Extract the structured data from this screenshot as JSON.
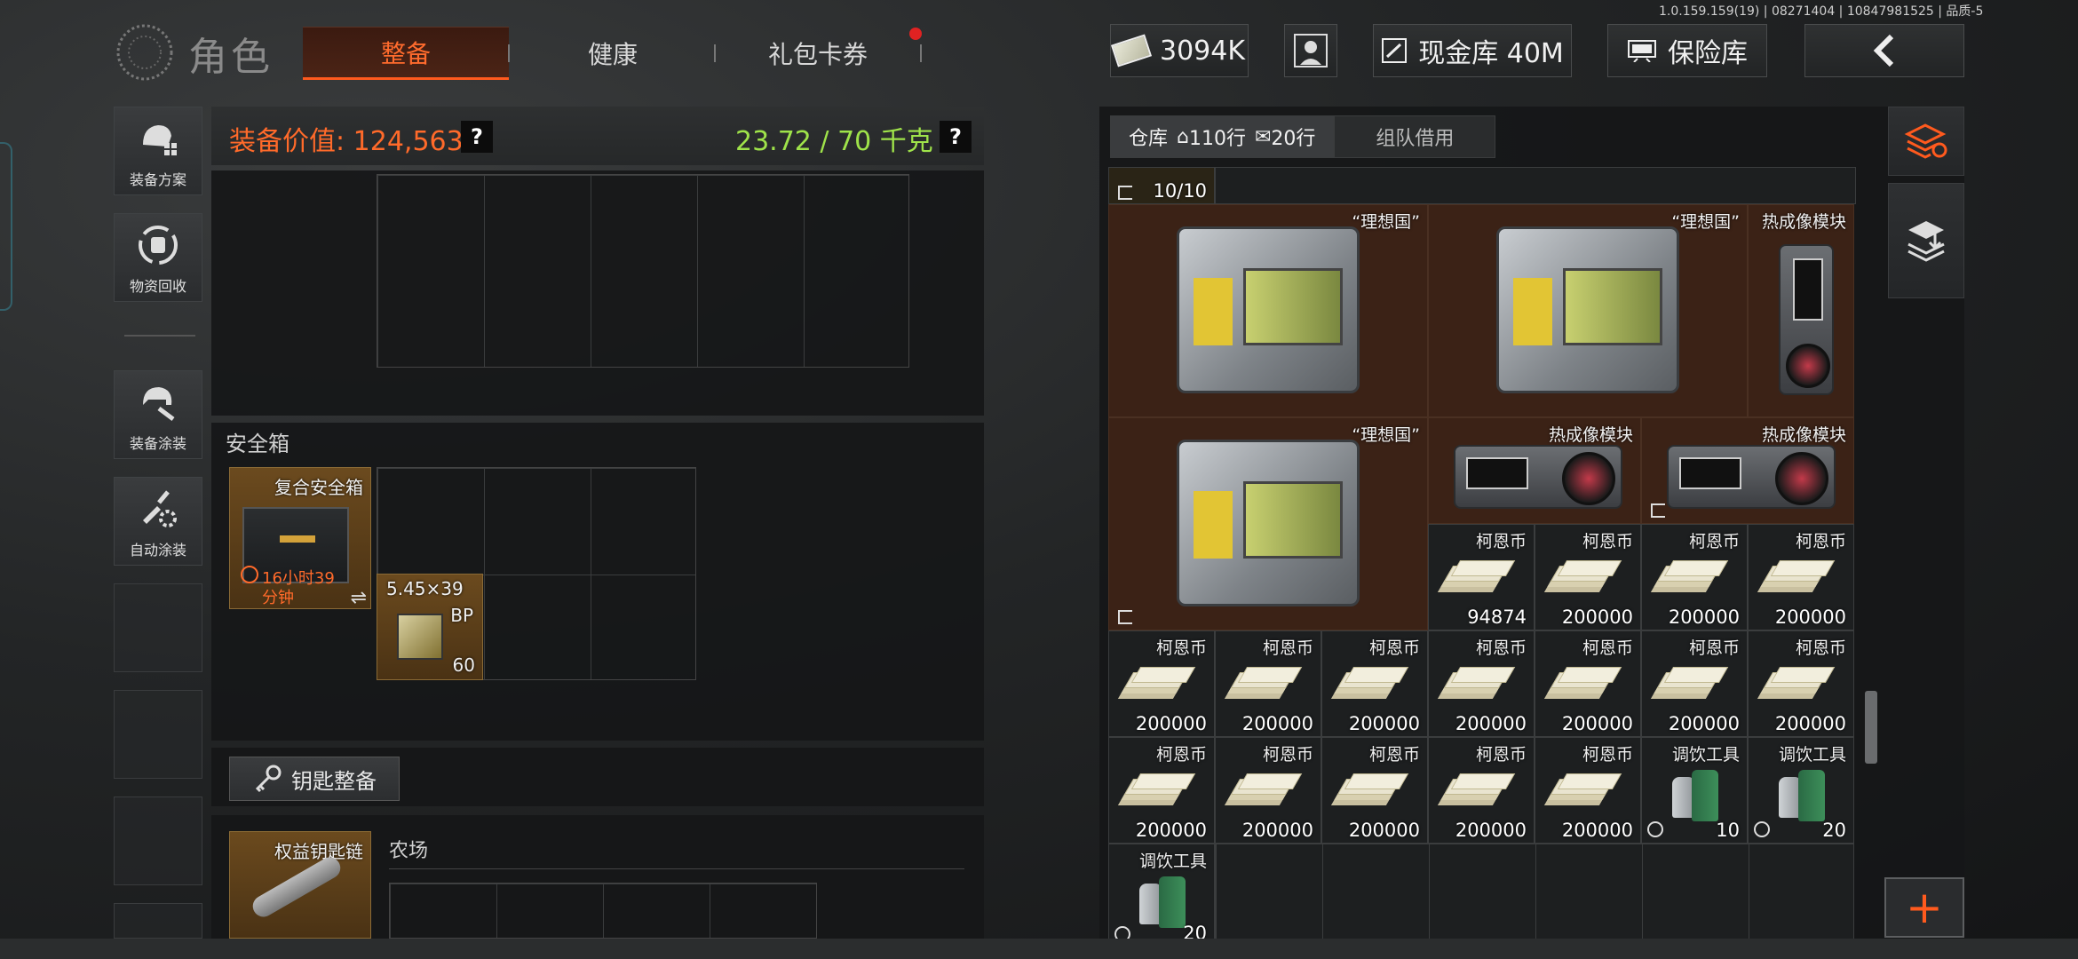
{
  "version": "1.0.159.159(19) | 08271404 | 10847981525 | 品质-5",
  "header": {
    "title": "角色",
    "tabs": [
      {
        "label": "整备",
        "active": true
      },
      {
        "label": "健康",
        "active": false
      },
      {
        "label": "礼包卡券",
        "active": false,
        "badge": true
      }
    ],
    "currency": "3094K",
    "cash_vault": "现金库 40M",
    "insurance": "保险库",
    "back_icon": "chevron-left-icon"
  },
  "sidebar": {
    "items": [
      {
        "label": "装备方案",
        "icon": "loadout-icon"
      },
      {
        "label": "物资回收",
        "icon": "recycle-icon"
      },
      {
        "label": "装备涂装",
        "icon": "paint-icon"
      },
      {
        "label": "自动涂装",
        "icon": "auto-paint-icon"
      }
    ]
  },
  "loadout": {
    "value_label": "装备价值: 124,563",
    "weight": "23.72 / 70 千克",
    "help": "?",
    "safebox": {
      "title": "安全箱",
      "container": {
        "name": "复合安全箱",
        "timer_line1": "16小时39",
        "timer_line2": "分钟"
      },
      "ammo": {
        "name": "5.45×39",
        "sub": "BP",
        "count": "60"
      }
    },
    "keys": {
      "button": "钥匙整备",
      "chain_name": "权益钥匙链",
      "location": "农场"
    }
  },
  "storage": {
    "tabs": [
      {
        "label": "仓库",
        "rows": "110行",
        "tickets": "20行",
        "active": true
      },
      {
        "label": "组队借用",
        "active": false
      }
    ],
    "top_count": "10/10",
    "items": {
      "ideal": "“理想国”",
      "thermal": "热成像模块",
      "coin": "柯恩币",
      "bar": "调饮工具"
    },
    "coin_counts": [
      "94874",
      "200000"
    ],
    "bar_counts": [
      "10",
      "20",
      "20"
    ]
  },
  "colors": {
    "accent": "#ff5a1e",
    "weight_green": "#9fe34a",
    "item_gold": "#6b4a1e",
    "brown_cell": "#3b2216"
  }
}
